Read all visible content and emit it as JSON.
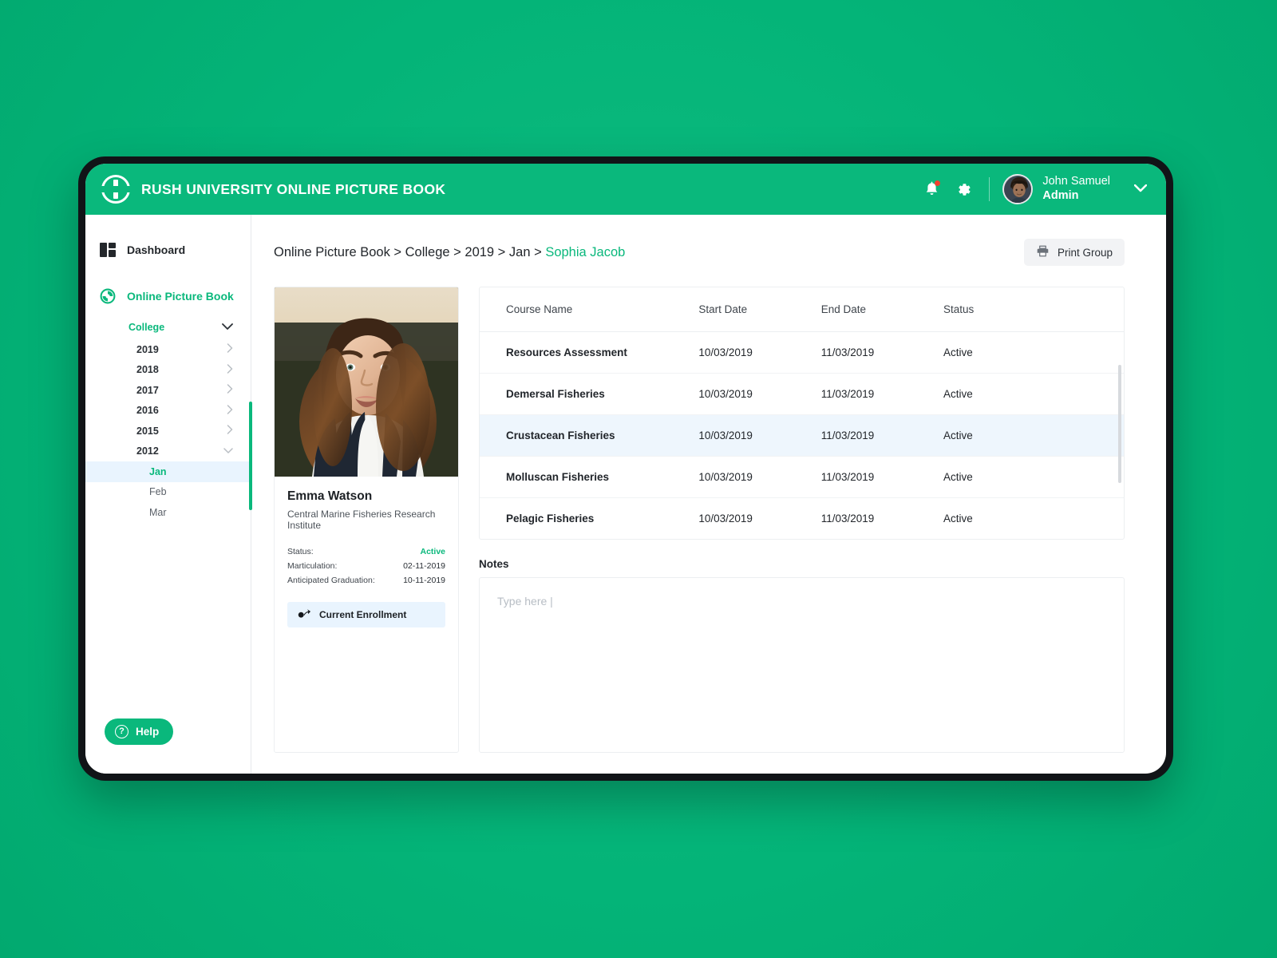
{
  "appbar": {
    "brand_title": "RUSH UNIVERSITY ONLINE PICTURE BOOK",
    "logo_icon": "rush-logo-icon",
    "notifications_icon": "bell-icon",
    "settings_icon": "gear-icon",
    "user_name": "John Samuel",
    "user_role": "Admin",
    "caret_icon": "chevron-down-icon",
    "accent_color": "#0ab87c"
  },
  "sidebar": {
    "dashboard": {
      "label": "Dashboard",
      "icon": "dashboard-grid-icon"
    },
    "picture_book": {
      "label": "Online Picture Book",
      "icon": "picture-book-icon"
    },
    "college": {
      "label": "College",
      "caret": "chevron-down-icon"
    },
    "years": [
      {
        "label": "2019",
        "caret": "chevron-right-icon",
        "expanded": false
      },
      {
        "label": "2018",
        "caret": "chevron-right-icon",
        "expanded": false
      },
      {
        "label": "2017",
        "caret": "chevron-right-icon",
        "expanded": false
      },
      {
        "label": "2016",
        "caret": "chevron-right-icon",
        "expanded": false
      },
      {
        "label": "2015",
        "caret": "chevron-right-icon",
        "expanded": false
      },
      {
        "label": "2012",
        "caret": "chevron-down-icon",
        "expanded": true
      }
    ],
    "months": [
      {
        "label": "Jan",
        "active": true
      },
      {
        "label": "Feb",
        "active": false
      },
      {
        "label": "Mar",
        "active": false
      }
    ],
    "help": {
      "label": "Help",
      "icon": "question-circle-icon"
    }
  },
  "main": {
    "breadcrumb": {
      "trail": "Online Picture Book > College > 2019 > Jan > ",
      "current": "Sophia Jacob"
    },
    "print_group": {
      "label": "Print Group",
      "icon": "printer-icon"
    }
  },
  "profile": {
    "photo_alt": "student-portrait",
    "name": "Emma Watson",
    "organization": "Central Marine Fisheries Research Institute",
    "meta": [
      {
        "label": "Status:",
        "value": "Active",
        "status": true
      },
      {
        "label": "Marticulation:",
        "value": "02-11-2019",
        "status": false
      },
      {
        "label": "Anticipated Graduation:",
        "value": "10-11-2019",
        "status": false
      }
    ],
    "enrollment_button": {
      "label": "Current Enrollment",
      "icon": "enrollment-icon"
    }
  },
  "courses": {
    "columns": [
      "Course Name",
      "Start Date",
      "End Date",
      "Status"
    ],
    "rows": [
      {
        "name": "Resources Assessment",
        "start": "10/03/2019",
        "end": "11/03/2019",
        "status": "Active",
        "selected": false
      },
      {
        "name": "Demersal Fisheries",
        "start": "10/03/2019",
        "end": "11/03/2019",
        "status": "Active",
        "selected": false
      },
      {
        "name": "Crustacean Fisheries",
        "start": "10/03/2019",
        "end": "11/03/2019",
        "status": "Active",
        "selected": true
      },
      {
        "name": "Molluscan Fisheries",
        "start": "10/03/2019",
        "end": "11/03/2019",
        "status": "Active",
        "selected": false
      },
      {
        "name": "Pelagic Fisheries",
        "start": "10/03/2019",
        "end": "11/03/2019",
        "status": "Active",
        "selected": false
      }
    ]
  },
  "notes": {
    "label": "Notes",
    "placeholder": "Type here |",
    "value": ""
  }
}
